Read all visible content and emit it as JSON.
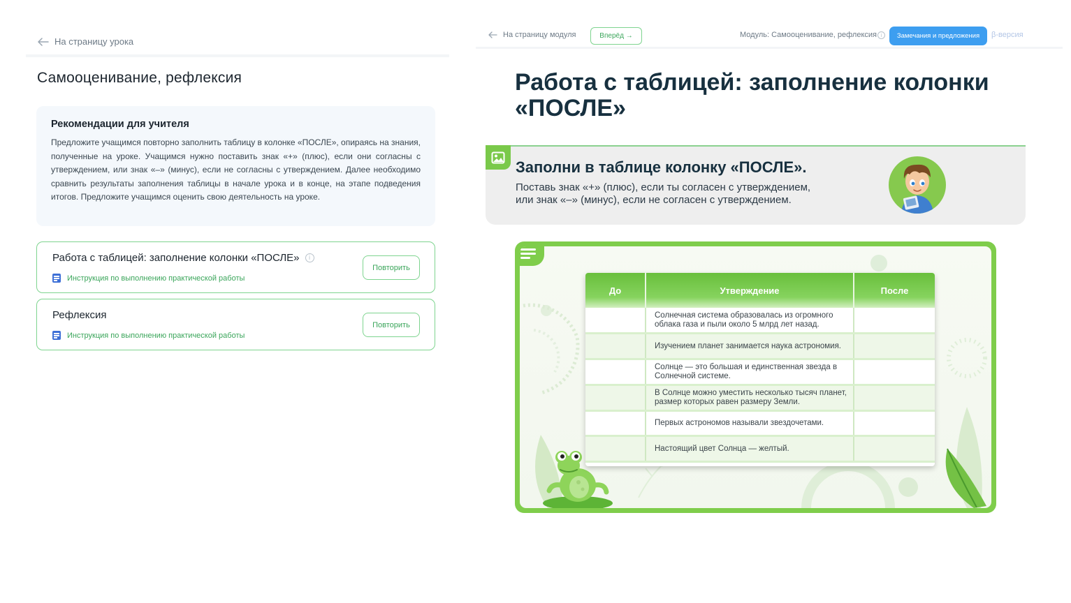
{
  "left": {
    "back_link": "На страницу урока",
    "title": "Самооценивание, рефлексия",
    "recommendations": {
      "title": "Рекомендации для учителя",
      "text": "Предложите учащимся повторно заполнить таблицу в колонке «ПОСЛЕ», опираясь на знания, полученные на уроке. Учащимся нужно поставить знак «+» (плюс), если они согласны с утверждением, или знак «–» (минус), если не согласны с утверждением. Далее необходимо сравнить результаты заполнения таблицы в начале урока и в конце, на этапе подведения итогов. Предложите учащимся оценить свою деятельность на уроке."
    },
    "tasks": [
      {
        "title": "Работа с таблицей: заполнение колонки «ПОСЛЕ»",
        "link": "Инструкция по выполнению практической работы",
        "button": "Повторить"
      },
      {
        "title": "Рефлексия",
        "link": "Инструкция по выполнению практической работы",
        "button": "Повторить"
      }
    ]
  },
  "right": {
    "topbar": {
      "back_link": "На страницу модуля",
      "forward": "Вперёд",
      "module": "Модуль: Самооценивание, рефлексия",
      "feedback": "Замечания и предложения",
      "beta": "β-версия"
    },
    "title": "Работа с таблицей: заполнение колонки «ПОСЛЕ»",
    "task": {
      "heading": "Заполни в таблице колонку «ПОСЛЕ».",
      "desc_line1": "Поставь знак «+» (плюс), если ты согласен с утверждением,",
      "desc_line2": "или знак «–» (минус), если не согласен с утверждением."
    },
    "table": {
      "headers": [
        "До",
        "Утверждение",
        "После"
      ],
      "rows": [
        "Солнечная система образовалась из огромного облака газа и пыли около 5 млрд лет назад.",
        "Изучением планет занимается наука астрономия.",
        "Солнце — это большая и единственная звезда в Солнечной системе.",
        "В Солнце можно уместить несколько тысяч планет, размер которых равен размеру Земли.",
        "Первых астрономов называли звездочетами.",
        "Настоящий цвет Солнца — желтый."
      ]
    }
  },
  "colors": {
    "accent_green": "#7fcd4b",
    "link_green": "#3aa55a",
    "feedback_blue": "#3d9ef0",
    "title_dark": "#17303f"
  },
  "icons": [
    "arrow-left-icon",
    "info-icon",
    "document-icon",
    "arrow-right-icon",
    "image-icon",
    "menu-icon",
    "boy-avatar",
    "frog-illustration"
  ]
}
